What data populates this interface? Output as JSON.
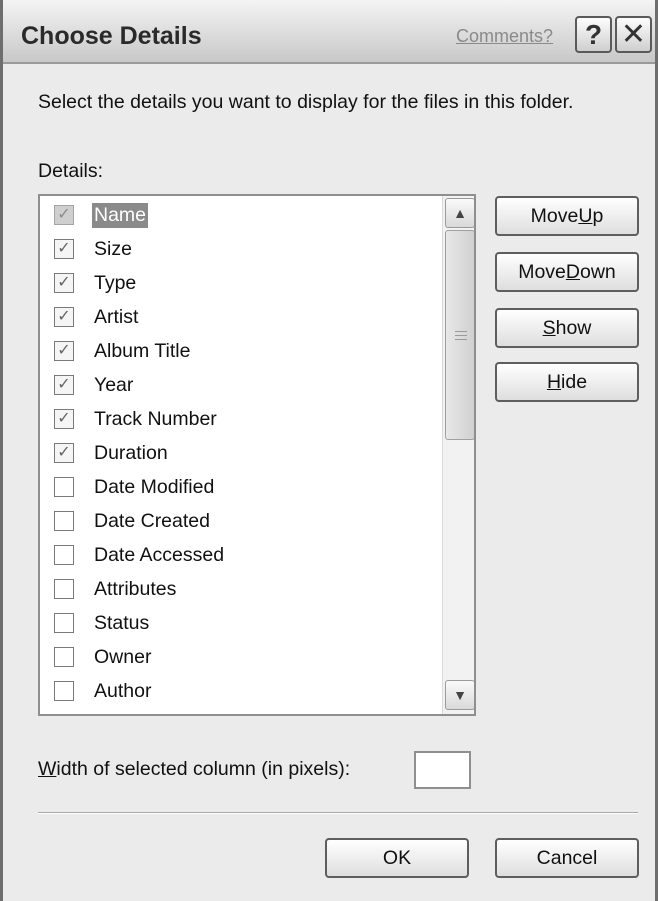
{
  "dialog": {
    "title": "Choose Details",
    "comments_link": "Comments?",
    "help_glyph": "?",
    "close_glyph": "✕"
  },
  "instruction": "Select the details you want to display for the files in this folder.",
  "details_label": "Details:",
  "details_list": [
    {
      "label": "Name",
      "checked": true,
      "disabled": true,
      "selected": true
    },
    {
      "label": "Size",
      "checked": true
    },
    {
      "label": "Type",
      "checked": true
    },
    {
      "label": "Artist",
      "checked": true
    },
    {
      "label": "Album Title",
      "checked": true
    },
    {
      "label": "Year",
      "checked": true
    },
    {
      "label": "Track Number",
      "checked": true
    },
    {
      "label": "Duration",
      "checked": true
    },
    {
      "label": "Date Modified",
      "checked": false
    },
    {
      "label": "Date Created",
      "checked": false
    },
    {
      "label": "Date Accessed",
      "checked": false
    },
    {
      "label": "Attributes",
      "checked": false
    },
    {
      "label": "Status",
      "checked": false
    },
    {
      "label": "Owner",
      "checked": false
    },
    {
      "label": "Author",
      "checked": false
    },
    {
      "label": "",
      "checked": false
    }
  ],
  "buttons": {
    "move_up": {
      "before": "Move ",
      "key": "U",
      "after": "p"
    },
    "move_down": {
      "before": "Move ",
      "key": "D",
      "after": "own"
    },
    "show": {
      "before": "",
      "key": "S",
      "after": "how"
    },
    "hide": {
      "before": "",
      "key": "H",
      "after": "ide"
    },
    "ok": "OK",
    "cancel": "Cancel"
  },
  "width_field": {
    "label_key": "W",
    "label_rest": "idth of selected column (in pixels):",
    "value": ""
  },
  "icons": {
    "check": "✓",
    "scroll_up": "▲",
    "scroll_down": "▼"
  },
  "colors": {
    "selection_bg": "#8a8a8a",
    "dialog_bg": "#ebebeb"
  }
}
